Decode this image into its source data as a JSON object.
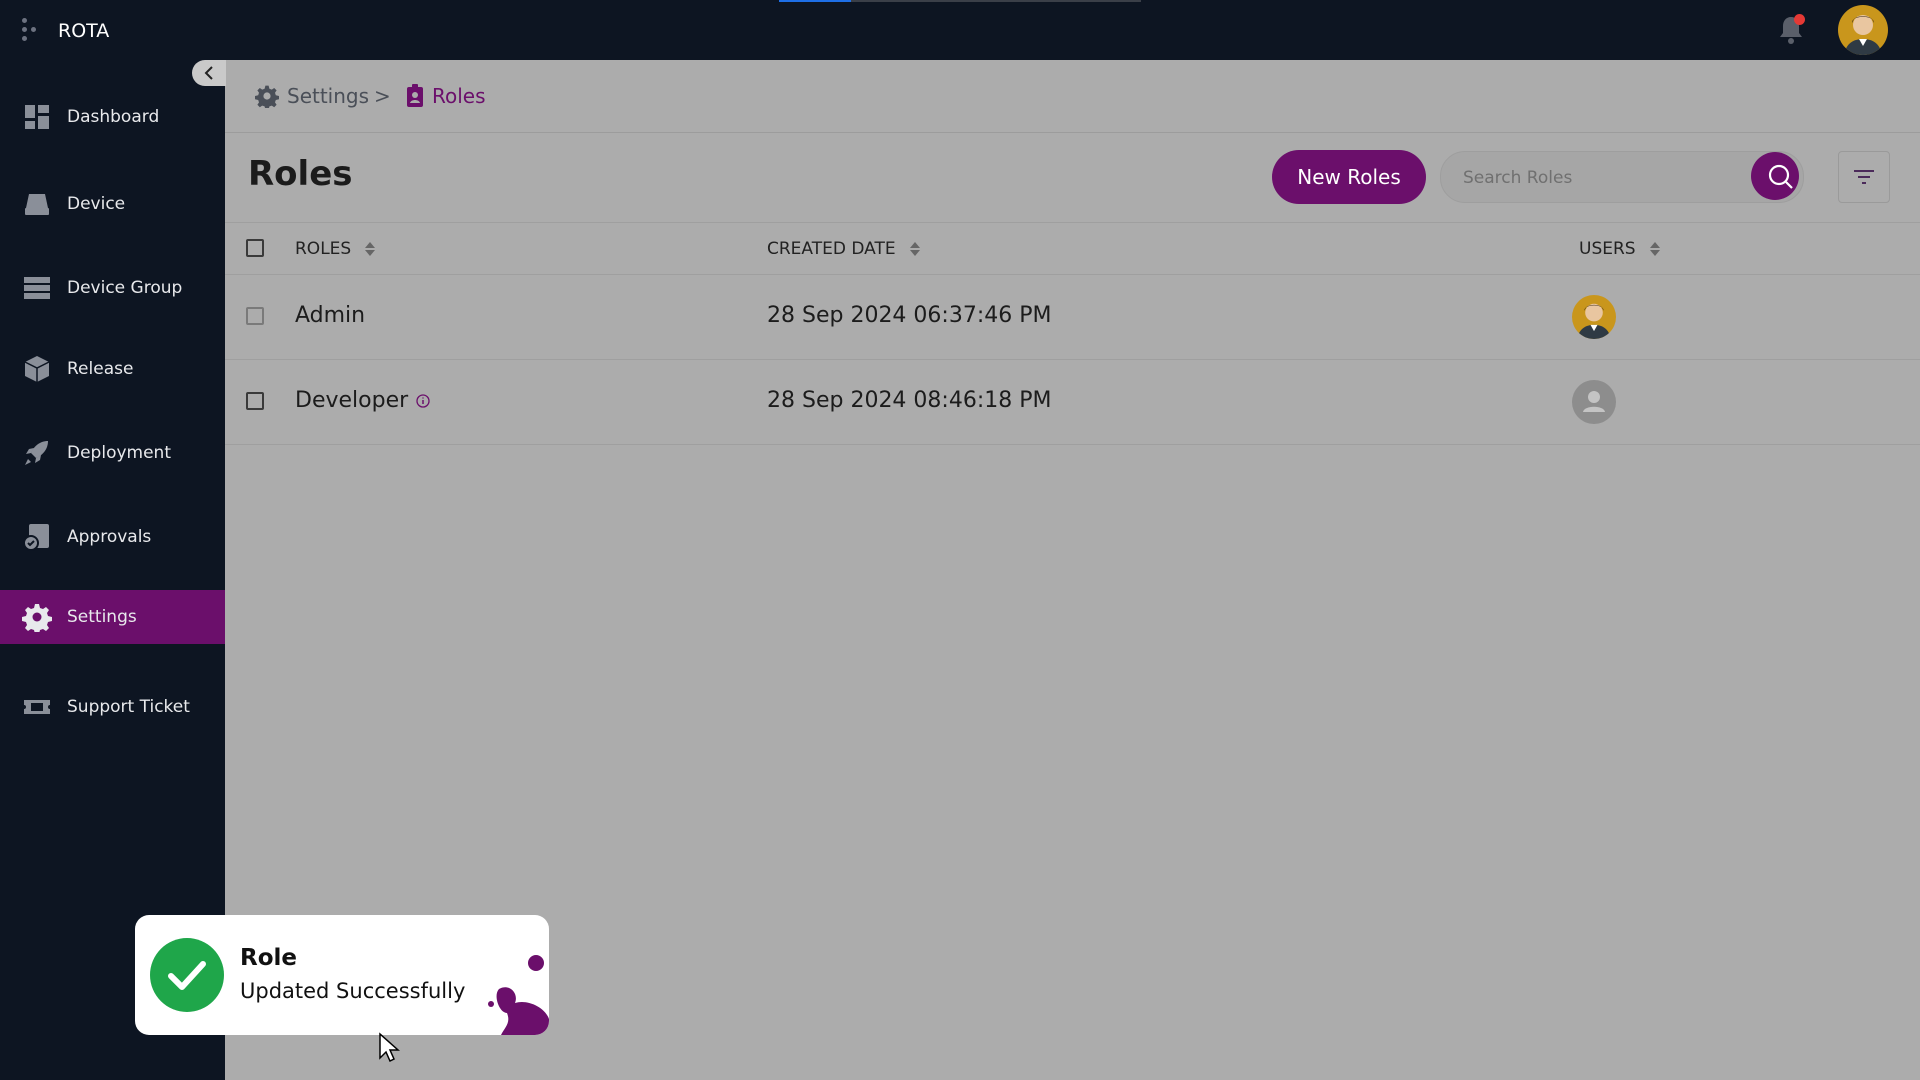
{
  "app": {
    "name": "ROTA"
  },
  "loading": {
    "progress": 0.2
  },
  "notifications": {
    "has_unread": true
  },
  "sidebar": {
    "items": [
      {
        "label": "Dashboard",
        "icon": "dashboard-icon"
      },
      {
        "label": "Device",
        "icon": "device-icon"
      },
      {
        "label": "Device Group",
        "icon": "server-rack-icon"
      },
      {
        "label": "Release",
        "icon": "package-icon"
      },
      {
        "label": "Deployment",
        "icon": "rocket-icon"
      },
      {
        "label": "Approvals",
        "icon": "approval-doc-icon"
      },
      {
        "label": "Settings",
        "icon": "gear-icon",
        "active": true
      },
      {
        "label": "Support Ticket",
        "icon": "ticket-icon"
      }
    ]
  },
  "breadcrumb": {
    "parent": "Settings",
    "separator": ">",
    "current": "Roles"
  },
  "page": {
    "title": "Roles",
    "new_button": "New Roles",
    "search_placeholder": "Search Roles"
  },
  "table": {
    "columns": [
      "ROLES",
      "CREATED DATE",
      "USERS"
    ],
    "rows": [
      {
        "role": "Admin",
        "created": "28 Sep 2024 06:37:46 PM",
        "user_avatar": "photo-avatar"
      },
      {
        "role": "Developer",
        "created": "28 Sep 2024 08:46:18 PM",
        "user_avatar": "default-avatar",
        "info_icon": true
      }
    ]
  },
  "toast": {
    "title": "Role",
    "message": "Updated Successfully"
  },
  "colors": {
    "primary": "#6b0f6b",
    "sidebar_bg": "#0d1522",
    "success": "#1fa64a",
    "overlay": "#acacac"
  }
}
